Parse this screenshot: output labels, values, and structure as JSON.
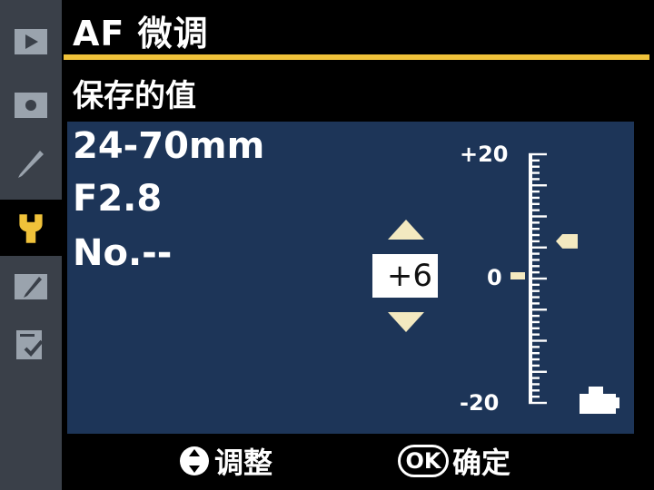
{
  "header": {
    "title": "AF 微调"
  },
  "section": {
    "title": "保存的值"
  },
  "lens": {
    "focal": "24-70mm",
    "aperture": "F2.8",
    "number": "No.--"
  },
  "adjust": {
    "value": "+6"
  },
  "scale": {
    "max_label": "+20",
    "zero_label": "0",
    "min_label": "-20",
    "min": -20,
    "max": 20,
    "saved_value": 6
  },
  "footer": {
    "adjust_label": "调整",
    "ok_badge": "OK",
    "ok_label": "确定"
  },
  "sidebar": {
    "items": [
      {
        "icon": "playback-icon"
      },
      {
        "icon": "shooting-icon"
      },
      {
        "icon": "custom-settings-pencil-icon"
      },
      {
        "icon": "setup-wrench-icon",
        "active": true
      },
      {
        "icon": "retouch-icon"
      },
      {
        "icon": "my-menu-icon"
      }
    ]
  },
  "colors": {
    "accent": "#f0c23a",
    "panel": "#1d3558",
    "sidebar": "#3a4049"
  }
}
